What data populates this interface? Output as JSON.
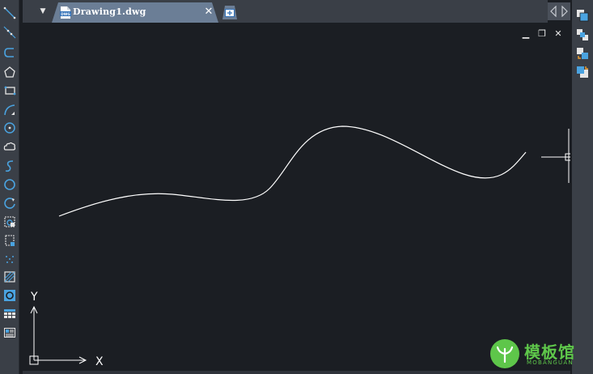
{
  "document": {
    "tab_title": "Drawing1.dwg",
    "file_badge": "DWG"
  },
  "tab_controls": {
    "menu_glyph": "▼",
    "close_glyph": "✕",
    "new_tab_glyph": "+"
  },
  "window_controls": {
    "minimize": "▁",
    "restore": "❐",
    "close": "✕"
  },
  "ucs": {
    "x_label": "X",
    "y_label": "Y"
  },
  "watermark": {
    "title": "模板馆",
    "subtitle": "MOBANGUAN"
  },
  "left_tools": [
    {
      "icon": "line-icon"
    },
    {
      "icon": "construction-line-icon"
    },
    {
      "icon": "polyline-icon"
    },
    {
      "icon": "polygon-icon"
    },
    {
      "icon": "rectangle-icon"
    },
    {
      "icon": "arc-icon"
    },
    {
      "icon": "circle-icon"
    },
    {
      "icon": "revision-cloud-icon"
    },
    {
      "icon": "spline-icon"
    },
    {
      "icon": "ellipse-icon"
    },
    {
      "icon": "ellipse-arc-icon"
    },
    {
      "icon": "insert-block-icon"
    },
    {
      "icon": "make-block-icon"
    },
    {
      "icon": "point-icon"
    },
    {
      "icon": "hatch-icon"
    },
    {
      "icon": "region-icon"
    },
    {
      "icon": "table-icon"
    },
    {
      "icon": "multiline-text-icon"
    }
  ],
  "right_tools": [
    {
      "icon": "draw-order-front-icon"
    },
    {
      "icon": "draw-order-back-icon"
    },
    {
      "icon": "bring-above-icon"
    },
    {
      "icon": "send-under-icon"
    }
  ],
  "colors": {
    "canvas": "#1b1e23",
    "toolbar": "#3a3f47",
    "active_tab": "#6b7e96",
    "tool_accent": "#4aa3e0",
    "watermark": "#5ec64a"
  }
}
